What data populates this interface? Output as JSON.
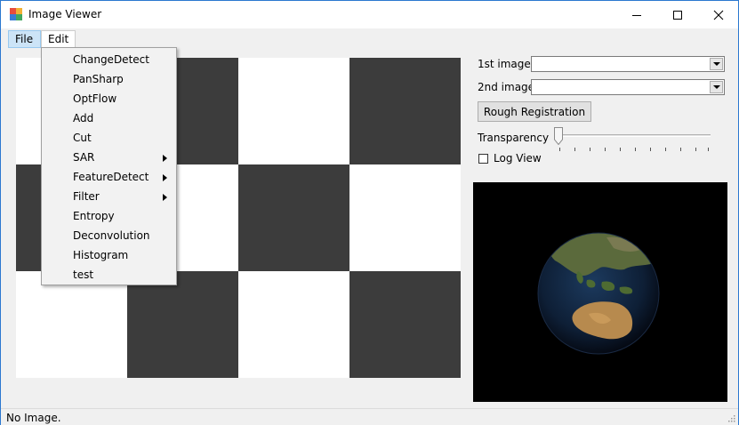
{
  "window": {
    "title": "Image Viewer"
  },
  "menubar": {
    "file": "File",
    "edit": "Edit"
  },
  "edit_menu": {
    "items": [
      {
        "label": "ChangeDetect",
        "has_submenu": false
      },
      {
        "label": "PanSharp",
        "has_submenu": false
      },
      {
        "label": "OptFlow",
        "has_submenu": false
      },
      {
        "label": "Add",
        "has_submenu": false
      },
      {
        "label": "Cut",
        "has_submenu": false
      },
      {
        "label": "SAR",
        "has_submenu": true
      },
      {
        "label": "FeatureDetect",
        "has_submenu": true
      },
      {
        "label": "Filter",
        "has_submenu": true
      },
      {
        "label": "Entropy",
        "has_submenu": false
      },
      {
        "label": "Deconvolution",
        "has_submenu": false
      },
      {
        "label": "Histogram",
        "has_submenu": false
      },
      {
        "label": "test",
        "has_submenu": false
      }
    ]
  },
  "panel": {
    "first_image_label": "1st image",
    "first_image_value": "",
    "second_image_label": "2nd image",
    "second_image_value": "",
    "rough_registration": "Rough Registration",
    "transparency_label": "Transparency",
    "transparency_value": 0,
    "log_view_label": "Log View",
    "log_view_checked": false
  },
  "status": {
    "text": "No Image."
  },
  "icons": [
    "app-icon",
    "minimize-icon",
    "maximize-icon",
    "close-icon",
    "chevron-down-icon",
    "chevron-right-icon",
    "resize-grip-icon"
  ],
  "colors": {
    "accent": "#cce4f7",
    "checker_dark": "#3c3c3c",
    "checker_light": "#ffffff"
  }
}
